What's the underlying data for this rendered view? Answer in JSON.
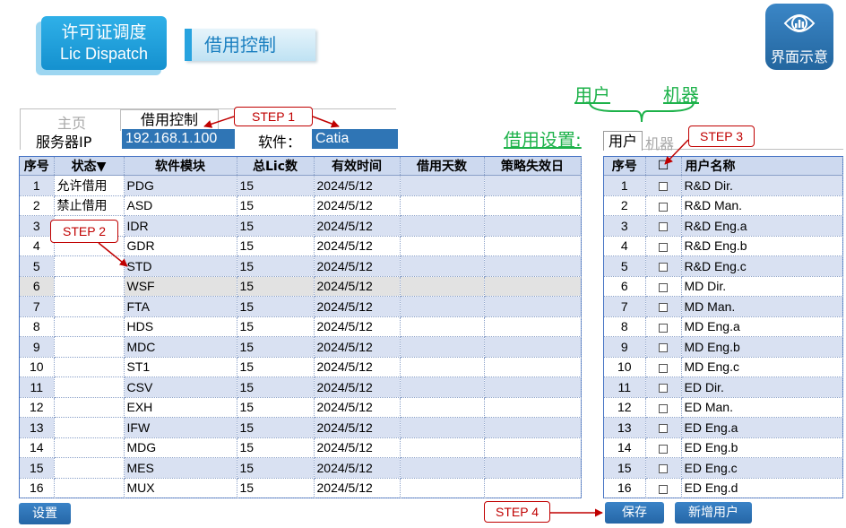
{
  "header": {
    "title_cn": "许可证调度",
    "title_en": "Lic Dispatch",
    "subtitle": "借用控制",
    "logo_label": "界面示意",
    "logo_icon": "eye-chart-icon"
  },
  "annotations": {
    "user_label": "用户",
    "machine_label": "机器",
    "borrow_settings": "借用设置:",
    "step1": "STEP 1",
    "step2": "STEP 2",
    "step3": "STEP 3",
    "step4": "STEP 4"
  },
  "top_tabs": {
    "home": "主页",
    "borrow_control": "借用控制"
  },
  "server": {
    "label": "服务器IP",
    "ip": "192.168.1.100",
    "software_label": "软件：",
    "software": "Catia"
  },
  "right_tabs": {
    "user": "用户",
    "machine": "机器"
  },
  "left_table": {
    "columns": [
      "序号",
      "状态▼",
      "软件模块",
      "总Lic数",
      "有效时间",
      "借用天数",
      "策略失效日"
    ],
    "rows": [
      {
        "n": "1",
        "status": "允许借用",
        "module": "PDG",
        "total": "15",
        "time": "2024/5/12"
      },
      {
        "n": "2",
        "status": "禁止借用",
        "module": "ASD",
        "total": "15",
        "time": "2024/5/12"
      },
      {
        "n": "3",
        "status": "",
        "module": "IDR",
        "total": "15",
        "time": "2024/5/12"
      },
      {
        "n": "4",
        "status": "",
        "module": "GDR",
        "total": "15",
        "time": "2024/5/12"
      },
      {
        "n": "5",
        "status": "",
        "module": "STD",
        "total": "15",
        "time": "2024/5/12"
      },
      {
        "n": "6",
        "status": "",
        "module": "WSF",
        "total": "15",
        "time": "2024/5/12"
      },
      {
        "n": "7",
        "status": "",
        "module": "FTA",
        "total": "15",
        "time": "2024/5/12"
      },
      {
        "n": "8",
        "status": "",
        "module": "HDS",
        "total": "15",
        "time": "2024/5/12"
      },
      {
        "n": "9",
        "status": "",
        "module": "MDC",
        "total": "15",
        "time": "2024/5/12"
      },
      {
        "n": "10",
        "status": "",
        "module": "ST1",
        "total": "15",
        "time": "2024/5/12"
      },
      {
        "n": "11",
        "status": "",
        "module": "CSV",
        "total": "15",
        "time": "2024/5/12"
      },
      {
        "n": "12",
        "status": "",
        "module": "EXH",
        "total": "15",
        "time": "2024/5/12"
      },
      {
        "n": "13",
        "status": "",
        "module": "IFW",
        "total": "15",
        "time": "2024/5/12"
      },
      {
        "n": "14",
        "status": "",
        "module": "MDG",
        "total": "15",
        "time": "2024/5/12"
      },
      {
        "n": "15",
        "status": "",
        "module": "MES",
        "total": "15",
        "time": "2024/5/12"
      },
      {
        "n": "16",
        "status": "",
        "module": "MUX",
        "total": "15",
        "time": "2024/5/12"
      }
    ]
  },
  "right_table": {
    "columns": [
      "序号",
      "☐",
      "用户名称"
    ],
    "rows": [
      {
        "n": "1",
        "name": "R&D Dir."
      },
      {
        "n": "2",
        "name": "R&D Man."
      },
      {
        "n": "3",
        "name": "R&D Eng.a"
      },
      {
        "n": "4",
        "name": "R&D Eng.b"
      },
      {
        "n": "5",
        "name": "R&D Eng.c"
      },
      {
        "n": "6",
        "name": "MD Dir."
      },
      {
        "n": "7",
        "name": "MD Man."
      },
      {
        "n": "8",
        "name": "MD Eng.a"
      },
      {
        "n": "9",
        "name": "MD Eng.b"
      },
      {
        "n": "10",
        "name": "MD Eng.c"
      },
      {
        "n": "11",
        "name": "ED Dir."
      },
      {
        "n": "12",
        "name": "ED Man."
      },
      {
        "n": "13",
        "name": "ED Eng.a"
      },
      {
        "n": "14",
        "name": "ED Eng.b"
      },
      {
        "n": "15",
        "name": "ED Eng.c"
      },
      {
        "n": "16",
        "name": "ED Eng.d"
      }
    ]
  },
  "buttons": {
    "settings": "设置",
    "save": "保存",
    "add_user": "新增用户"
  },
  "colors": {
    "accent": "#2f75b5",
    "header_row": "#cdd9ef",
    "alt_row": "#d9e1f2",
    "step": "#c00000",
    "green": "#1db24a"
  }
}
